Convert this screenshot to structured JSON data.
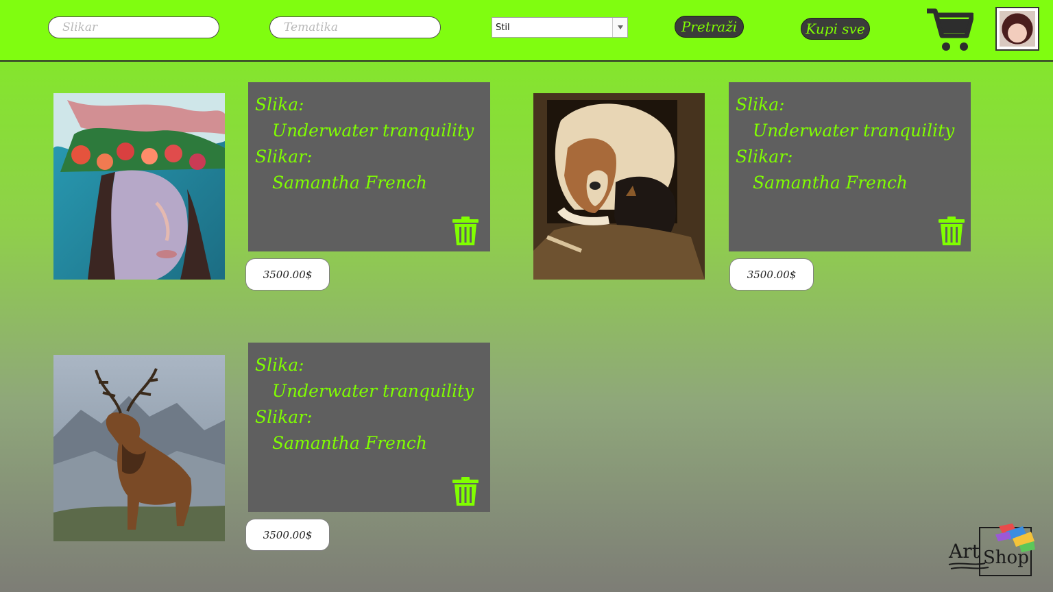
{
  "header": {
    "painter_placeholder": "Slikar",
    "theme_placeholder": "Tematika",
    "style_select_value": "Stil",
    "search_label": "Pretraži",
    "buy_all_label": "Kupi sve"
  },
  "items": [
    {
      "painting_label": "Slika:",
      "painting_title": "Underwater tranquility",
      "painter_label": "Slikar:",
      "painter_name": "Samantha French",
      "price": "3500.00$",
      "image": "woman-flower-crown-painting"
    },
    {
      "painting_label": "Slika:",
      "painting_title": "Underwater tranquility",
      "painter_label": "Slikar:",
      "painter_name": "Samantha French",
      "price": "3500.00$",
      "image": "dogs-painting"
    },
    {
      "painting_label": "Slika:",
      "painting_title": "Underwater tranquility",
      "painter_label": "Slikar:",
      "painter_name": "Samantha French",
      "price": "3500.00$",
      "image": "stag-painting"
    }
  ],
  "logo": {
    "text_art": "Art",
    "text_shop": "Shop"
  },
  "colors": {
    "accent_green": "#80ff00",
    "card_gray": "#5f5f5f"
  }
}
